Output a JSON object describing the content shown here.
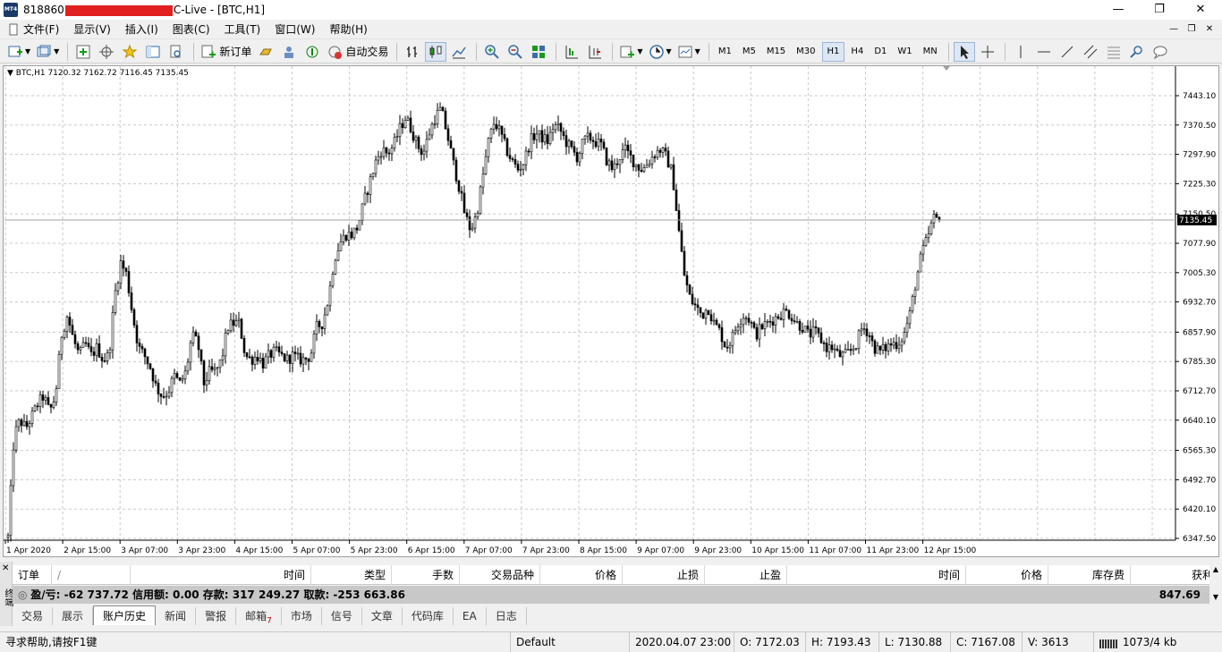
{
  "window": {
    "title_prefix": "818860",
    "title_suffix": "C-Live - [BTC,H1]",
    "minimize": "—",
    "maximize": "❐",
    "close": "✕"
  },
  "menu": {
    "items": [
      "文件(F)",
      "显示(V)",
      "插入(I)",
      "图表(C)",
      "工具(T)",
      "窗口(W)",
      "帮助(H)"
    ]
  },
  "toolbar": {
    "new_order": "新订单",
    "auto_trade": "自动交易",
    "timeframes": [
      "M1",
      "M5",
      "M15",
      "M30",
      "H1",
      "H4",
      "D1",
      "W1",
      "MN"
    ],
    "active_timeframe": "H1"
  },
  "chart": {
    "symbol_info": "BTC,H1  7120.32 7162.72 7116.45 7135.45",
    "current_price_label": "7135.45",
    "current_price": 7135.45
  },
  "chart_data": {
    "type": "candlestick",
    "symbol": "BTC",
    "timeframe": "H1",
    "ylim": [
      6347.5,
      7480
    ],
    "y_ticks": [
      "7443.10",
      "7370.50",
      "7297.90",
      "7225.30",
      "7150.50",
      "7077.90",
      "7005.30",
      "6932.70",
      "6857.90",
      "6785.30",
      "6712.70",
      "6640.10",
      "6565.30",
      "6492.70",
      "6420.10",
      "6347.50"
    ],
    "x_ticks": [
      "1 Apr 2020",
      "2 Apr 15:00",
      "3 Apr 07:00",
      "3 Apr 23:00",
      "4 Apr 15:00",
      "5 Apr 07:00",
      "5 Apr 23:00",
      "6 Apr 15:00",
      "7 Apr 07:00",
      "7 Apr 23:00",
      "8 Apr 15:00",
      "9 Apr 07:00",
      "9 Apr 23:00",
      "10 Apr 15:00",
      "11 Apr 07:00",
      "11 Apr 23:00",
      "12 Apr 15:00"
    ],
    "close_path": [
      6350,
      6600,
      6640,
      6620,
      6650,
      6680,
      6700,
      6660,
      6700,
      6850,
      6900,
      6840,
      6800,
      6830,
      6800,
      6820,
      6790,
      6800,
      6950,
      7030,
      7000,
      6900,
      6820,
      6800,
      6770,
      6720,
      6700,
      6710,
      6750,
      6730,
      6760,
      6850,
      6830,
      6730,
      6760,
      6760,
      6790,
      6870,
      6880,
      6880,
      6800,
      6790,
      6800,
      6780,
      6800,
      6810,
      6800,
      6790,
      6800,
      6790,
      6790,
      6800,
      6870,
      6880,
      6940,
      7040,
      7080,
      7100,
      7100,
      7120,
      7180,
      7230,
      7280,
      7310,
      7300,
      7320,
      7360,
      7390,
      7360,
      7320,
      7300,
      7350,
      7390,
      7410,
      7350,
      7280,
      7220,
      7150,
      7110,
      7150,
      7240,
      7330,
      7380,
      7350,
      7310,
      7280,
      7260,
      7280,
      7330,
      7350,
      7340,
      7330,
      7370,
      7360,
      7330,
      7310,
      7290,
      7330,
      7340,
      7330,
      7320,
      7280,
      7260,
      7290,
      7310,
      7290,
      7270,
      7260,
      7280,
      7300,
      7310,
      7290,
      7250,
      7120,
      7000,
      6940,
      6920,
      6900,
      6920,
      6880,
      6860,
      6820,
      6840,
      6880,
      6900,
      6890,
      6850,
      6870,
      6880,
      6890,
      6900,
      6910,
      6900,
      6880,
      6870,
      6850,
      6860,
      6840,
      6820,
      6820,
      6800,
      6800,
      6810,
      6830,
      6870,
      6860,
      6820,
      6810,
      6820,
      6830,
      6830,
      6850,
      6900,
      6980,
      7050,
      7090,
      7140,
      7135
    ]
  },
  "terminal": {
    "side_label": "终端",
    "columns": [
      "订单",
      "/",
      "时间",
      "类型",
      "手数",
      "交易品种",
      "价格",
      "止损",
      "止盈",
      "时间",
      "价格",
      "库存费",
      "获利"
    ],
    "summary": "盈/亏: -62 737.72  信用额: 0.00  存款: 317 249.27  取款: -253 663.86",
    "summary_right": "847.69",
    "tabs": [
      "交易",
      "展示",
      "账户历史",
      "新闻",
      "警报",
      "邮箱",
      "市场",
      "信号",
      "文章",
      "代码库",
      "EA",
      "日志"
    ],
    "active_tab": "账户历史",
    "mail_badge": "7"
  },
  "statusbar": {
    "help": "寻求帮助,请按F1键",
    "profile": "Default",
    "datetime": "2020.04.07 23:00",
    "open": "O: 7172.03",
    "high": "H: 7193.43",
    "low": "L: 7130.88",
    "close": "C: 7167.08",
    "volume": "V: 3613",
    "traffic": "1073/4 kb"
  },
  "colors": {
    "candle": "#000000",
    "grid": "#c8c8c8",
    "chart_bg": "#ffffff",
    "price_label_bg": "#000000",
    "title_redact": "#e02020"
  }
}
